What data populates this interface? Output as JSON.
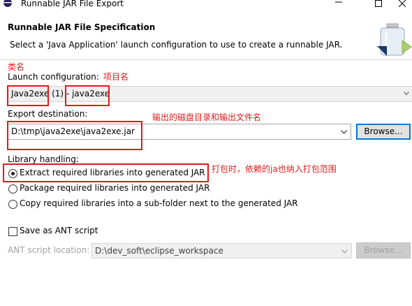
{
  "window": {
    "title": "Runnable JAR File Export",
    "minimize_glyph": "—",
    "maximize_glyph": "☐",
    "close_glyph": "✕"
  },
  "banner": {
    "title": "Runnable JAR File Specification",
    "message": "Select a 'Java Application' launch configuration to use to create a runnable JAR."
  },
  "launch": {
    "label": "Launch configuration:",
    "value_part1": "Java2exe",
    "value_part2": "(1) -",
    "value_part3": "java2exe"
  },
  "export": {
    "label": "Export destination:",
    "value": "D:\\tmp\\java2exe\\java2exe.jar",
    "browse_label": "Browse..."
  },
  "library": {
    "label": "Library handling:",
    "options": [
      "Extract required libraries into generated JAR",
      "Package required libraries into generated JAR",
      "Copy required libraries into a sub-folder next to the generated JAR"
    ],
    "selected_index": 0
  },
  "ant": {
    "checkbox_label": "Save as ANT script",
    "location_label": "ANT script location:",
    "location_value": "D:\\dev_soft\\eclipse_workspace",
    "browse_label": "Browse..."
  },
  "annotations": {
    "class_name": "类名",
    "project_name": "项目名",
    "output_note": "输出的磁盘目录和输出文件名",
    "package_note": "打包时，依赖的ja也纳入打包范围",
    "color": "#e11b1b"
  }
}
